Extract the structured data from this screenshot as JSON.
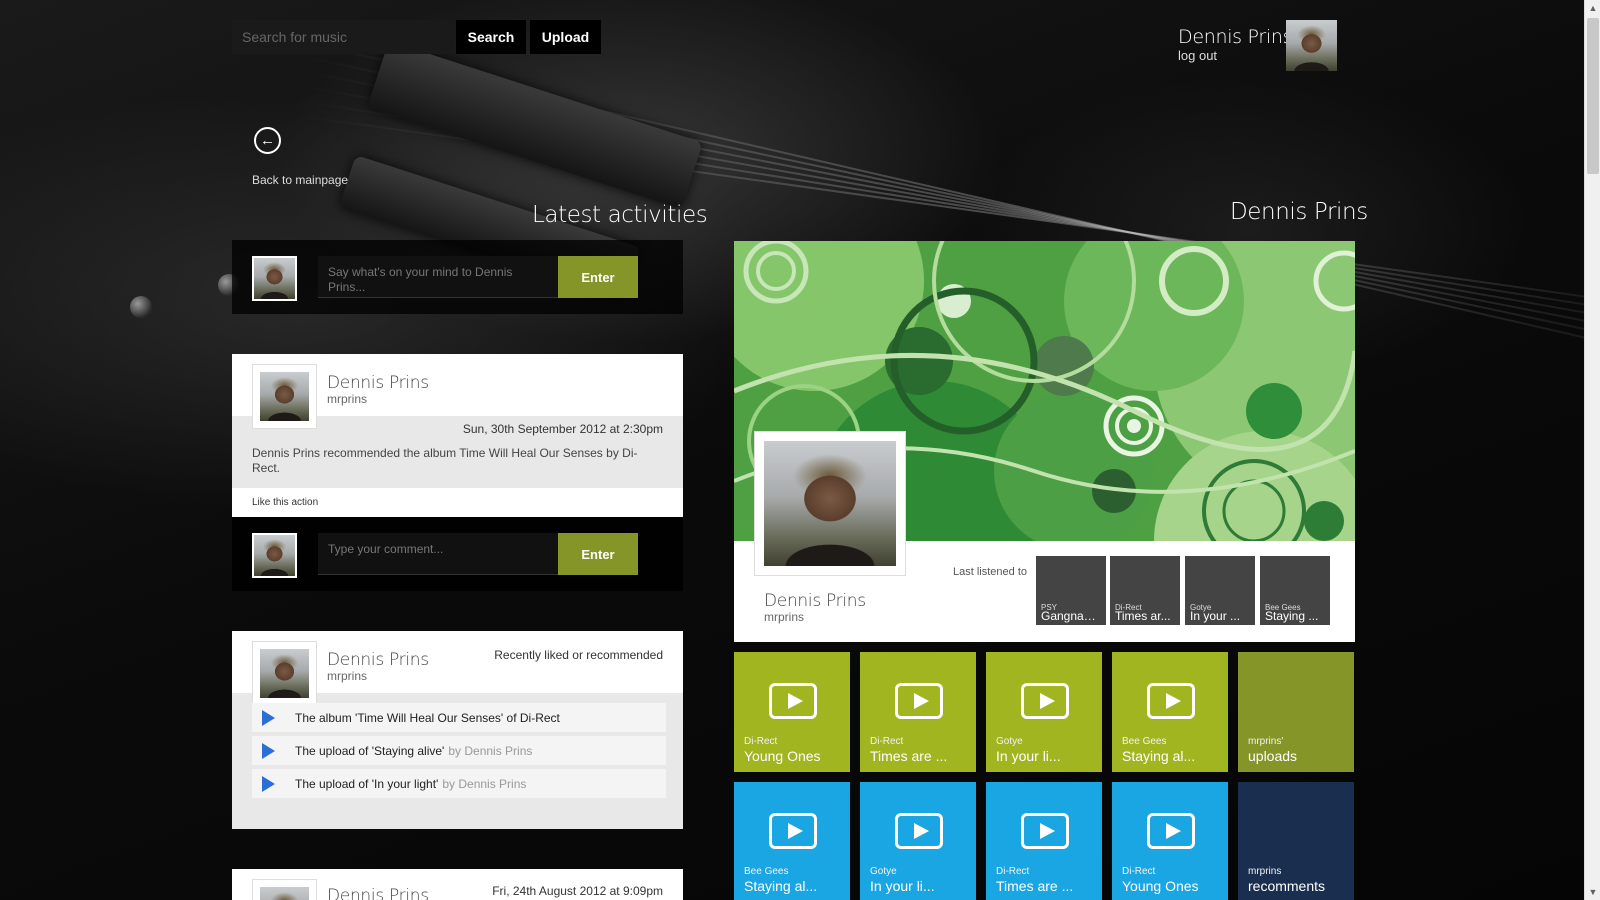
{
  "header": {
    "search_placeholder": "Search for music",
    "search_label": "Search",
    "upload_label": "Upload",
    "user_name": "Dennis Prins",
    "logout_label": "log out"
  },
  "nav": {
    "back_label": "Back to mainpage"
  },
  "activities": {
    "title": "Latest activities",
    "post_placeholder": "Say what's on your mind to Dennis Prins...",
    "enter_label": "Enter",
    "card1": {
      "name": "Dennis Prins",
      "handle": "mrprins",
      "date": "Sun, 30th September 2012 at 2:30pm",
      "text": "Dennis Prins recommended the album Time Will Heal Our Senses by Di-Rect.",
      "like_label": "Like this action"
    },
    "comment_placeholder": "Type your comment...",
    "card2": {
      "name": "Dennis Prins",
      "handle": "mrprins",
      "heading": "Recently liked or recommended",
      "items": [
        {
          "text": "The album 'Time Will Heal Our Senses' of Di-Rect",
          "by": ""
        },
        {
          "text": "The upload of 'Staying alive'",
          "by": "by Dennis Prins"
        },
        {
          "text": "The upload of 'In your light'",
          "by": "by Dennis Prins"
        }
      ]
    },
    "card3": {
      "name": "Dennis Prins",
      "date": "Fri, 24th August 2012 at 9:09pm"
    }
  },
  "profile": {
    "title": "Dennis Prins",
    "name": "Dennis Prins",
    "handle": "mrprins",
    "last_listened_label": "Last listened to",
    "last_listened": [
      {
        "artist": "PSY",
        "song": "Gangnam ..."
      },
      {
        "artist": "Di-Rect",
        "song": "Times ar..."
      },
      {
        "artist": "Gotye",
        "song": "In your ..."
      },
      {
        "artist": "Bee Gees",
        "song": "Staying ..."
      }
    ],
    "tiles_row1": [
      {
        "artist": "Di-Rect",
        "song": "Young Ones",
        "color": "green"
      },
      {
        "artist": "Di-Rect",
        "song": "Times are ...",
        "color": "green"
      },
      {
        "artist": "Gotye",
        "song": "In your li...",
        "color": "green"
      },
      {
        "artist": "Bee Gees",
        "song": "Staying al...",
        "color": "green"
      },
      {
        "artist": "mrprins'",
        "song": "uploads",
        "color": "olive"
      }
    ],
    "tiles_row2": [
      {
        "artist": "Bee Gees",
        "song": "Staying al...",
        "color": "blue"
      },
      {
        "artist": "Gotye",
        "song": "In your li...",
        "color": "blue"
      },
      {
        "artist": "Di-Rect",
        "song": "Times are ...",
        "color": "blue"
      },
      {
        "artist": "Di-Rect",
        "song": "Young Ones",
        "color": "blue"
      },
      {
        "artist": "mrprins",
        "song": "recomments",
        "color": "navy"
      }
    ]
  },
  "colors": {
    "accent_green": "#869527",
    "tile_green": "#a0b520",
    "tile_blue": "#1aa6e2",
    "tile_navy": "#1a2e4f",
    "play_blue": "#2b6fd6"
  }
}
